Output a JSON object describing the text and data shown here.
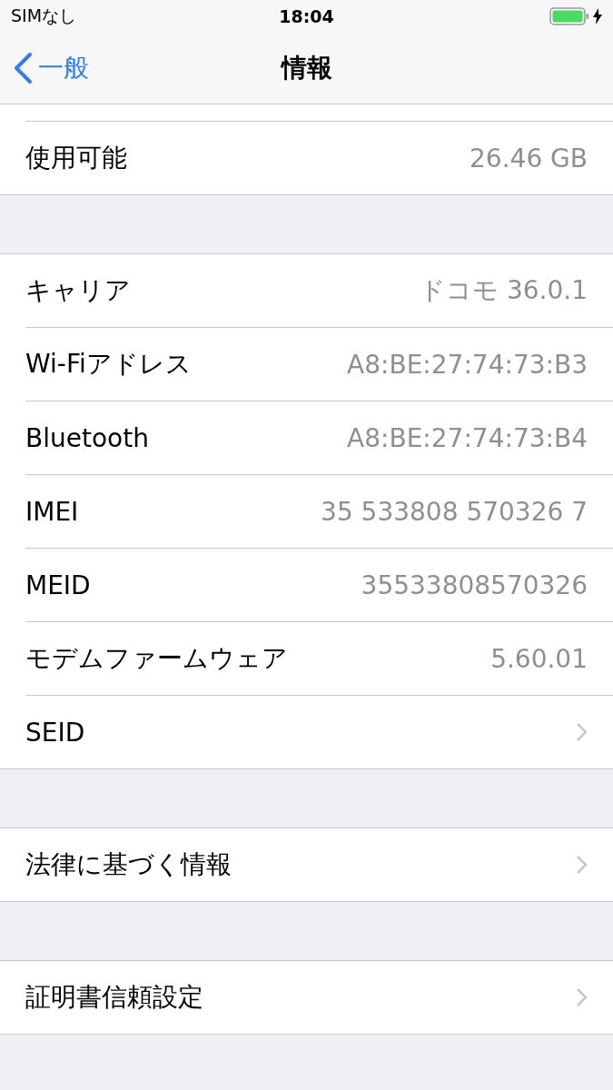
{
  "status_bar": {
    "carrier": "SIMなし",
    "time": "18:04"
  },
  "nav": {
    "back_label": "一般",
    "title": "情報"
  },
  "groups": [
    {
      "cut_top": true,
      "rows": [
        {
          "kind": "value",
          "label": "使用可能",
          "value": "26.46 GB"
        }
      ]
    },
    {
      "cut_top": false,
      "rows": [
        {
          "kind": "value",
          "label": "キャリア",
          "value": "ドコモ 36.0.1"
        },
        {
          "kind": "value",
          "label": "Wi-Fiアドレス",
          "value": "A8:BE:27:74:73:B3"
        },
        {
          "kind": "value",
          "label": "Bluetooth",
          "value": "A8:BE:27:74:73:B4"
        },
        {
          "kind": "value",
          "label": "IMEI",
          "value": "35 533808 570326 7"
        },
        {
          "kind": "value",
          "label": "MEID",
          "value": "35533808570326"
        },
        {
          "kind": "value",
          "label": "モデムファームウェア",
          "value": "5.60.01"
        },
        {
          "kind": "link",
          "label": "SEID"
        }
      ]
    },
    {
      "cut_top": false,
      "rows": [
        {
          "kind": "link",
          "label": "法律に基づく情報"
        }
      ]
    },
    {
      "cut_top": false,
      "rows": [
        {
          "kind": "link",
          "label": "証明書信頼設定"
        }
      ]
    }
  ]
}
